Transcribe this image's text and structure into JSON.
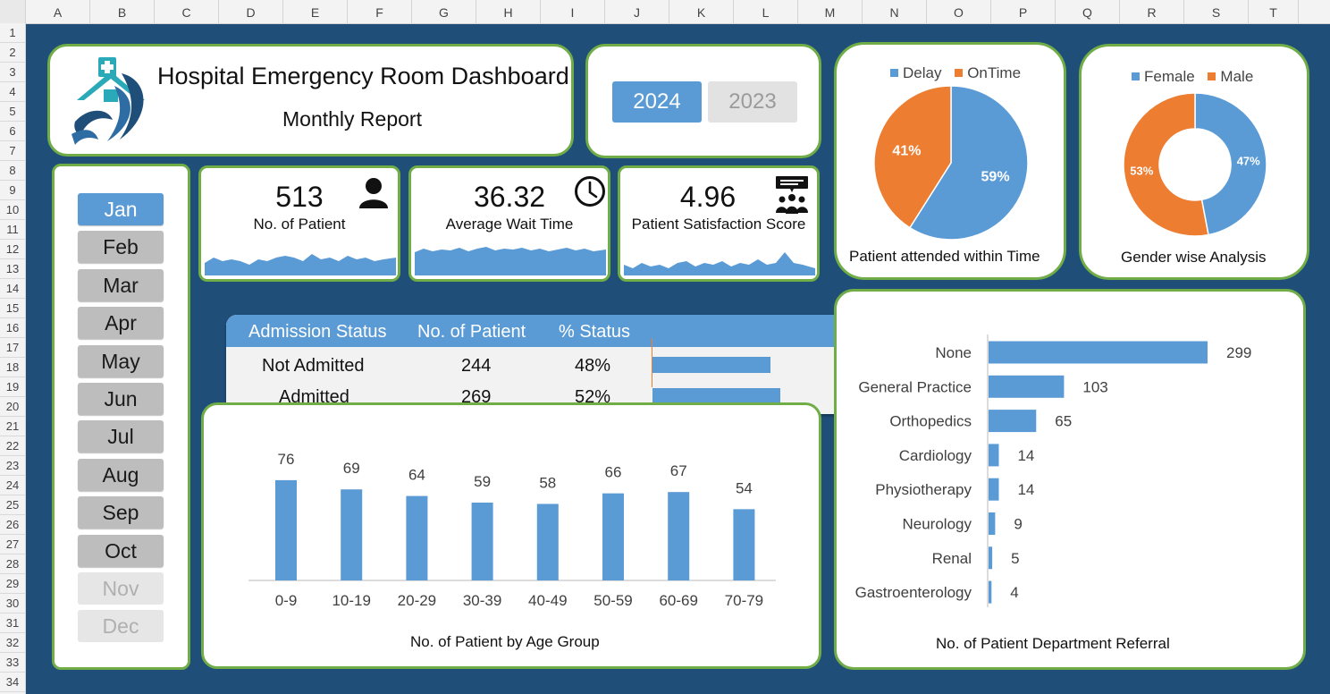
{
  "sheet": {
    "columns": [
      "A",
      "B",
      "C",
      "D",
      "E",
      "F",
      "G",
      "H",
      "I",
      "J",
      "K",
      "L",
      "M",
      "N",
      "O",
      "P",
      "Q",
      "R",
      "S",
      "T"
    ],
    "rows": [
      "1",
      "2",
      "3",
      "4",
      "5",
      "6",
      "7",
      "8",
      "9",
      "10",
      "11",
      "12",
      "13",
      "14",
      "15",
      "16",
      "17",
      "18",
      "19",
      "20",
      "21",
      "22",
      "23",
      "24",
      "25",
      "26",
      "27",
      "28",
      "29",
      "30",
      "31",
      "32",
      "33",
      "34"
    ]
  },
  "header": {
    "title": "Hospital Emergency Room Dashboard",
    "subtitle": "Monthly Report"
  },
  "years": [
    {
      "label": "2024",
      "selected": true
    },
    {
      "label": "2023",
      "selected": false
    }
  ],
  "months": [
    {
      "label": "Jan",
      "state": "selected"
    },
    {
      "label": "Feb",
      "state": "available"
    },
    {
      "label": "Mar",
      "state": "available"
    },
    {
      "label": "Apr",
      "state": "available"
    },
    {
      "label": "May",
      "state": "available"
    },
    {
      "label": "Jun",
      "state": "available"
    },
    {
      "label": "Jul",
      "state": "available"
    },
    {
      "label": "Aug",
      "state": "available"
    },
    {
      "label": "Sep",
      "state": "available"
    },
    {
      "label": "Oct",
      "state": "available"
    },
    {
      "label": "Nov",
      "state": "disabled"
    },
    {
      "label": "Dec",
      "state": "disabled"
    }
  ],
  "kpis": [
    {
      "value": "513",
      "label": "No. of Patient",
      "icon": "person-icon"
    },
    {
      "value": "36.32",
      "label": "Average Wait Time",
      "icon": "clock-icon"
    },
    {
      "value": "4.96",
      "label": "Patient Satisfaction Score",
      "icon": "feedback-group-icon"
    }
  ],
  "admission": {
    "headers": [
      "Admission Status",
      "No. of Patient",
      "% Status"
    ],
    "rows": [
      {
        "status": "Not Admitted",
        "count": "244",
        "pct": "48%",
        "fraction": 0.48
      },
      {
        "status": "Admitted",
        "count": "269",
        "pct": "52%",
        "fraction": 0.52
      }
    ]
  },
  "colors": {
    "background": "#1f4e79",
    "card_border": "#70ad47",
    "blue": "#5b9bd5",
    "orange": "#ed7d31"
  },
  "chart_data": [
    {
      "type": "pie",
      "title": "Patient attended within Time",
      "legend": "top",
      "slices": [
        {
          "name": "Delay",
          "value": 59,
          "label": "59%",
          "color": "#5b9bd5"
        },
        {
          "name": "OnTime",
          "value": 41,
          "label": "41%",
          "color": "#ed7d31"
        }
      ]
    },
    {
      "type": "pie",
      "title": "Gender wise Analysis",
      "legend": "top",
      "donut": true,
      "slices": [
        {
          "name": "Female",
          "value": 47,
          "label": "47%",
          "color": "#5b9bd5"
        },
        {
          "name": "Male",
          "value": 53,
          "label": "53%",
          "color": "#ed7d31"
        }
      ]
    },
    {
      "type": "bar",
      "title": "No. of Patient by Age Group",
      "categories": [
        "0-9",
        "10-19",
        "20-29",
        "30-39",
        "40-49",
        "50-59",
        "60-69",
        "70-79"
      ],
      "values": [
        76,
        69,
        64,
        59,
        58,
        66,
        67,
        54
      ],
      "ylim": [
        0,
        80
      ],
      "grid": false
    },
    {
      "type": "bar",
      "orientation": "horizontal",
      "title": "No. of Patient Department Referral",
      "categories": [
        "None",
        "General Practice",
        "Orthopedics",
        "Cardiology",
        "Physiotherapy",
        "Neurology",
        "Renal",
        "Gastroenterology"
      ],
      "values": [
        299,
        103,
        65,
        14,
        14,
        9,
        5,
        4
      ],
      "xlim": [
        0,
        320
      ],
      "grid": false
    }
  ]
}
